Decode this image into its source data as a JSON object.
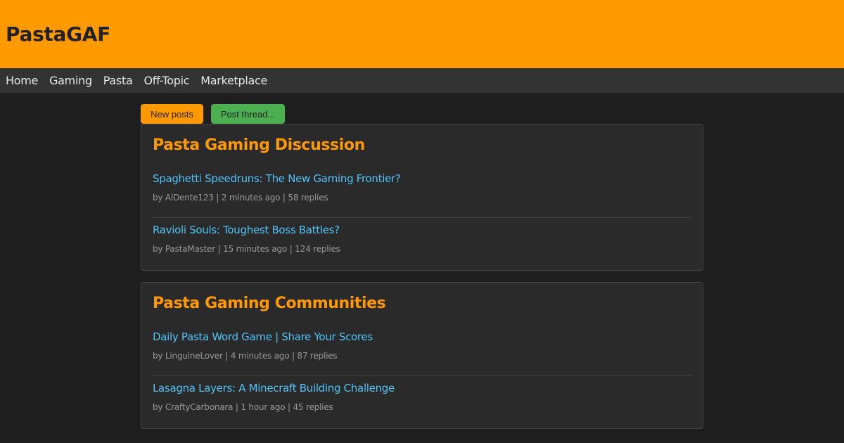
{
  "header": {
    "title": "PastaGAF"
  },
  "nav": {
    "items": [
      {
        "label": "Home"
      },
      {
        "label": "Gaming"
      },
      {
        "label": "Pasta"
      },
      {
        "label": "Off-Topic"
      },
      {
        "label": "Marketplace"
      }
    ]
  },
  "actions": {
    "new_posts": "New posts",
    "post_thread": "Post thread..."
  },
  "colors": {
    "accent": "#ff9900",
    "link": "#4fc3f7",
    "success": "#4caf50"
  },
  "sections": [
    {
      "title": "Pasta Gaming Discussion",
      "threads": [
        {
          "title": "Spaghetti Speedruns: The New Gaming Frontier?",
          "meta": "by AlDente123 | 2 minutes ago | 58 replies"
        },
        {
          "title": "Ravioli Souls: Toughest Boss Battles?",
          "meta": "by PastaMaster | 15 minutes ago | 124 replies"
        }
      ]
    },
    {
      "title": "Pasta Gaming Communities",
      "threads": [
        {
          "title": "Daily Pasta Word Game | Share Your Scores",
          "meta": "by LinguineLover | 4 minutes ago | 87 replies"
        },
        {
          "title": "Lasagna Layers: A Minecraft Building Challenge",
          "meta": "by CraftyCarbonara | 1 hour ago | 45 replies"
        }
      ]
    }
  ]
}
